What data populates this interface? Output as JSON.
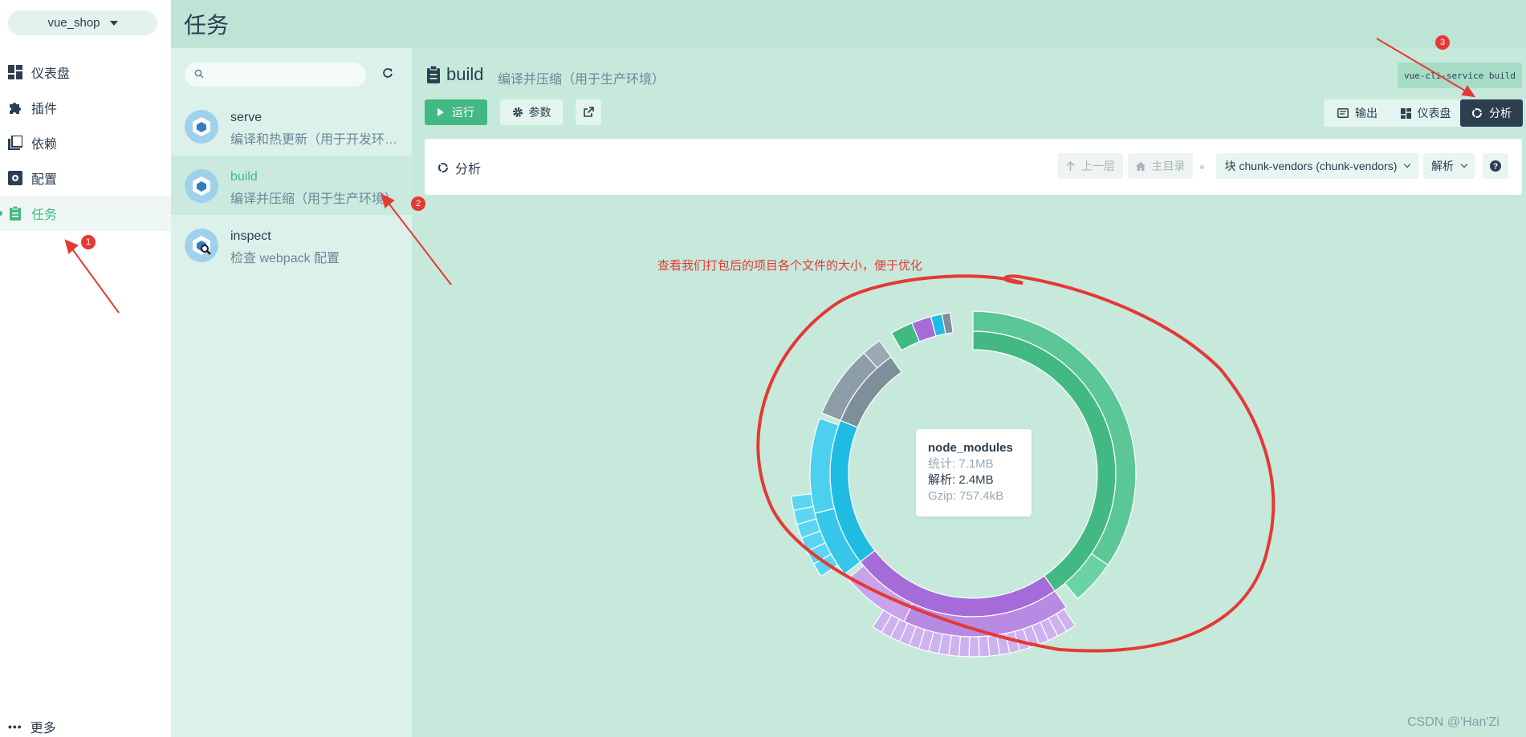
{
  "nav": {
    "project": "vue_shop",
    "items": [
      {
        "label": "仪表盘",
        "icon": "dashboard-icon"
      },
      {
        "label": "插件",
        "icon": "puzzle-icon"
      },
      {
        "label": "依赖",
        "icon": "library-icon"
      },
      {
        "label": "配置",
        "icon": "settings-icon"
      },
      {
        "label": "任务",
        "icon": "clipboard-icon",
        "active": true
      }
    ],
    "more": "更多"
  },
  "header": {
    "title": "任务"
  },
  "tasks": {
    "search_placeholder": "",
    "items": [
      {
        "name": "serve",
        "desc": "编译和热更新（用于开发环境）"
      },
      {
        "name": "build",
        "desc": "编译并压缩（用于生产环境）",
        "active": true
      },
      {
        "name": "inspect",
        "desc": "检查 webpack 配置"
      }
    ]
  },
  "detail": {
    "name": "build",
    "desc": "编译并压缩（用于生产环境）",
    "command": "vue-cli-service build",
    "run_label": "运行",
    "params_label": "参数",
    "views": [
      {
        "label": "输出",
        "icon": "terminal-icon"
      },
      {
        "label": "仪表盘",
        "icon": "dashboard-icon"
      },
      {
        "label": "分析",
        "icon": "donut-icon",
        "active": true
      }
    ],
    "analyzer": {
      "title": "分析",
      "up_label": "上一层",
      "home_label": "主目录",
      "chunk_label": "块 chunk-vendors (chunk-vendors)",
      "mode_label": "解析",
      "help_label": "?"
    },
    "tooltip": {
      "name": "node_modules",
      "stat": "统计: 7.1MB",
      "parsed": "解析: 2.4MB",
      "gzip": "Gzip: 757.4kB"
    }
  },
  "annotation": {
    "note": "查看我们打包后的项目各个文件的大小，便于优化",
    "badges": [
      "1",
      "2",
      "3"
    ]
  },
  "watermark": "CSDN @'Han'Zi",
  "colors": {
    "accent": "#42b983",
    "dark": "#2c3e50",
    "annotation": "#e53935"
  }
}
